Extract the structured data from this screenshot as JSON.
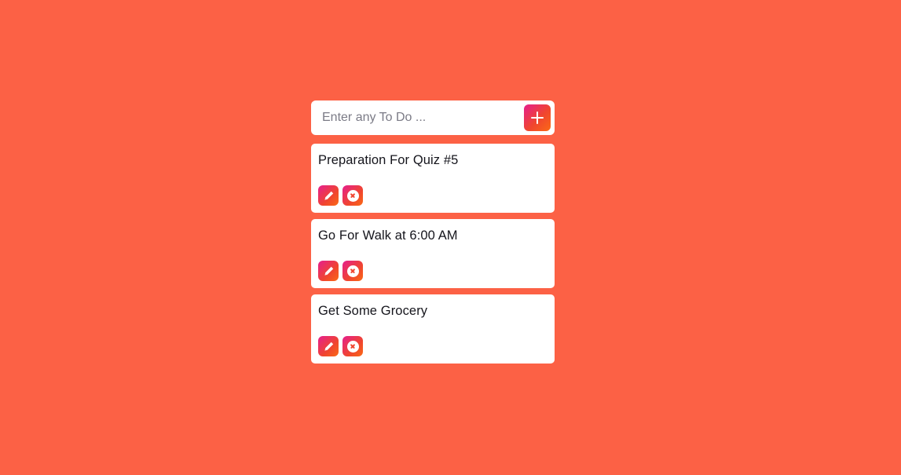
{
  "app": {
    "background_color": "#fc6145",
    "accent_gradient_start": "#e51f8e",
    "accent_gradient_end": "#fa6a15",
    "card_background": "#ffffff"
  },
  "input": {
    "value": "",
    "placeholder": "Enter any To Do ...",
    "add_button_label": "+",
    "add_button_icon": "plus-icon"
  },
  "todos": [
    {
      "title": "Preparation For Quiz #5",
      "edit_icon": "pen-icon",
      "delete_icon": "close-circle-icon"
    },
    {
      "title": "Go For Walk at 6:00 AM",
      "edit_icon": "pen-icon",
      "delete_icon": "close-circle-icon"
    },
    {
      "title": "Get Some Grocery",
      "edit_icon": "pen-icon",
      "delete_icon": "close-circle-icon"
    }
  ]
}
